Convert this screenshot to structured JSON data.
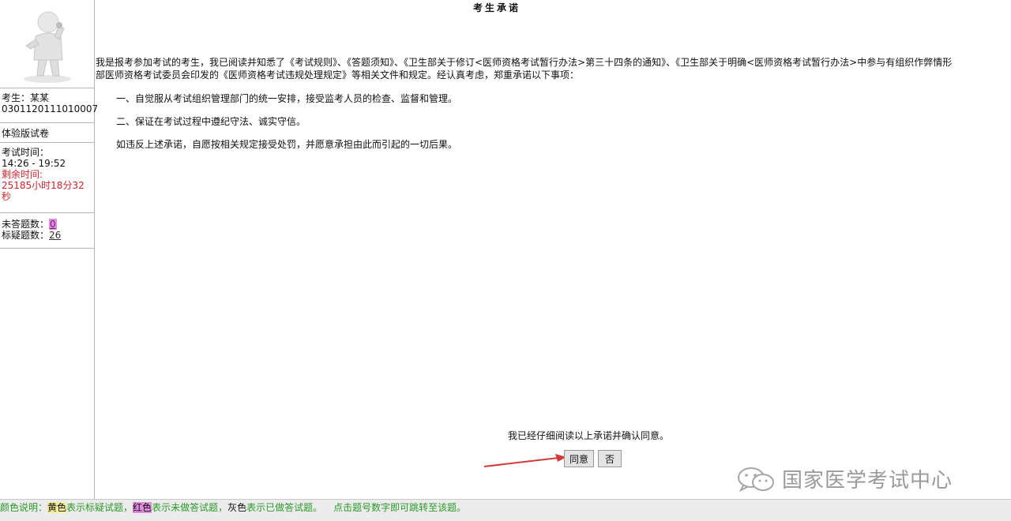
{
  "sidebar": {
    "candidate_label": "考生：某某",
    "candidate_id": "0301120111010007",
    "paper_type": "体验版试卷",
    "exam_time_label": "考试时间：",
    "exam_time_value": "14:26 - 19:52",
    "remaining_label": "剩余时间:",
    "remaining_value": "25185小时18分32",
    "remaining_unit": "秒",
    "unanswered_label": "未答题数：",
    "unanswered_count": "0",
    "flagged_label": "标疑题数：",
    "flagged_count": "26"
  },
  "main": {
    "title": "考生承诺",
    "intro_line1": "我是报考参加考试的考生，我已阅读并知悉了《考试规则》、《答题须知》、《卫生部关于修订<医师资格考试暂行办法>第三十四条的通知》、《卫生部关于明确<医师资格考试暂行办法>中参与有组织作弊情形",
    "intro_line2": "部医师资格考试委员会印发的《医师资格考试违规处理规定》等相关文件和规定。经认真考虑，郑重承诺以下事项：",
    "item1": "一、自觉服从考试组织管理部门的统一安排，接受监考人员的检查、监督和管理。",
    "item2": "二、保证在考试过程中遵纪守法、诚实守信。",
    "item3": "如违反上述承诺，自愿按相关规定接受处罚，并愿意承担由此而引起的一切后果。",
    "confirm_text": "我已经仔细阅读以上承诺并确认同意。",
    "agree_label": "同意",
    "no_label": "否"
  },
  "watermark": {
    "text": "国家医学考试中心",
    "icon": "wechat-icon"
  },
  "legend": {
    "prefix": "颜色说明：",
    "yellow_word": "黄色",
    "yellow_desc": "表示标疑试题，",
    "red_word": "红色",
    "red_desc": "表示未做答试题，",
    "gray_word": "灰色",
    "gray_desc": "表示已做答试题。",
    "tip": "点击题号数字即可跳转至该题。"
  },
  "colors": {
    "accent_red": "#d0232a",
    "highlight_magenta": "#e08de0",
    "legend_green": "#2a9a2a"
  }
}
